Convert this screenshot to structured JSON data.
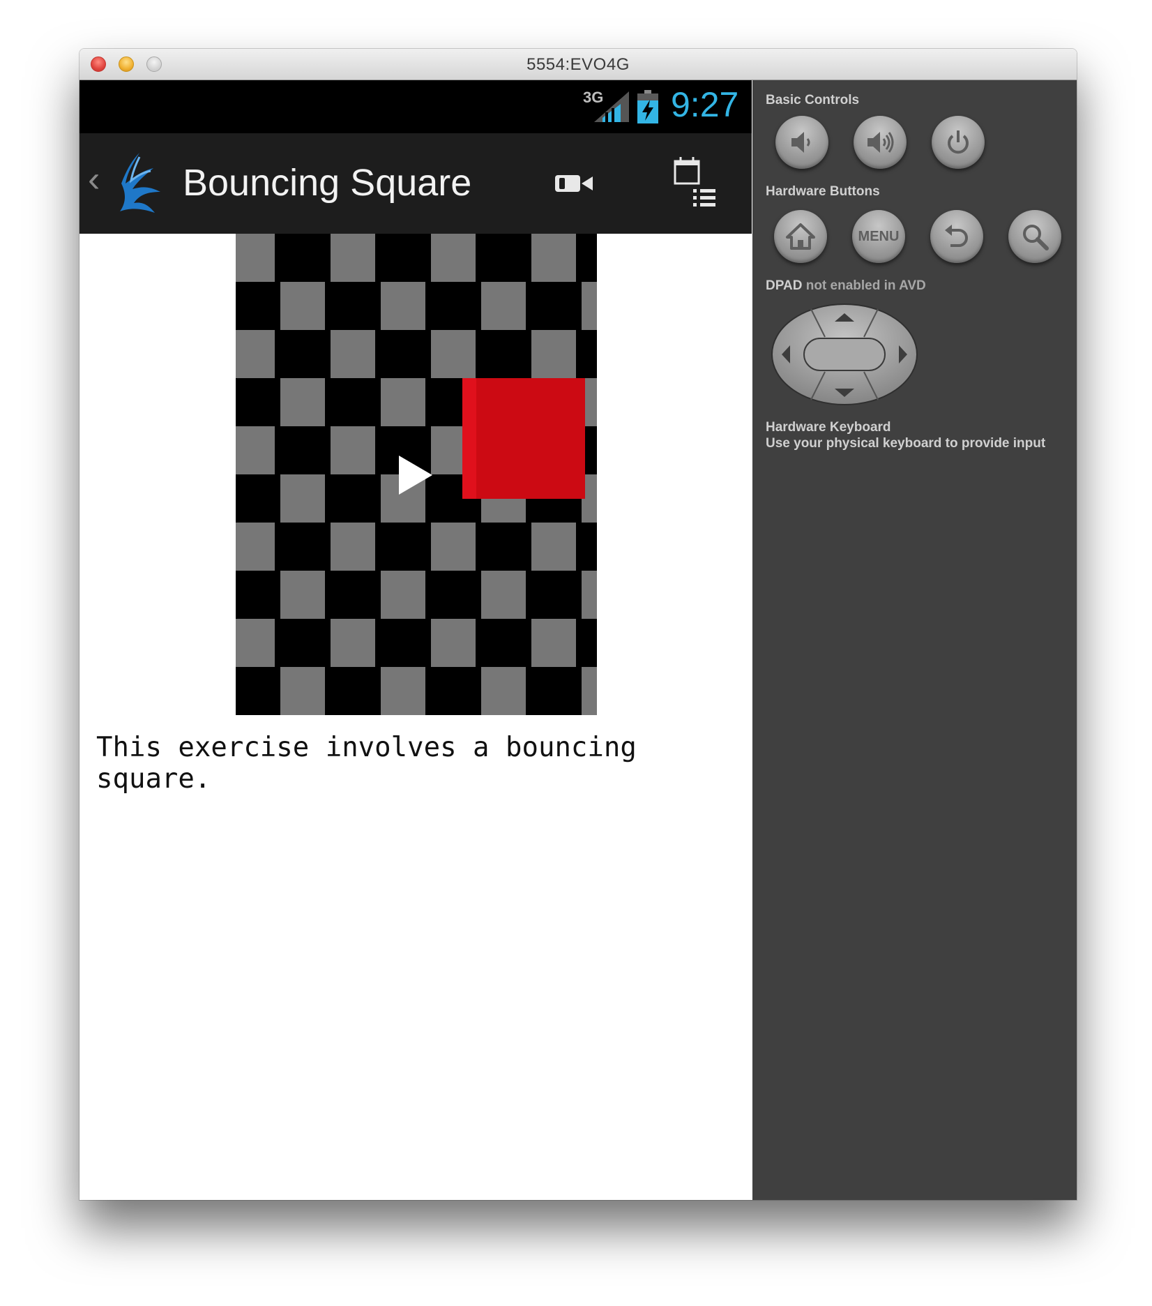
{
  "window": {
    "title": "5554:EVO4G"
  },
  "statusbar": {
    "network": "3G",
    "time": "9:27",
    "time_color": "#33b5e5"
  },
  "actionbar": {
    "title": "Bouncing Square"
  },
  "content": {
    "description": "This exercise involves a bouncing\nsquare.",
    "game": {
      "square_color": "#cc0a13",
      "light_tile": "#777777",
      "dark_tile": "#000000"
    }
  },
  "controls": {
    "basic_label": "Basic Controls",
    "hardware_label": "Hardware Buttons",
    "menu_label": "MENU",
    "dpad_label": "DPAD",
    "dpad_sub": "not enabled in AVD",
    "keyboard_label": "Hardware Keyboard",
    "keyboard_desc": "Use your physical keyboard to provide input"
  }
}
